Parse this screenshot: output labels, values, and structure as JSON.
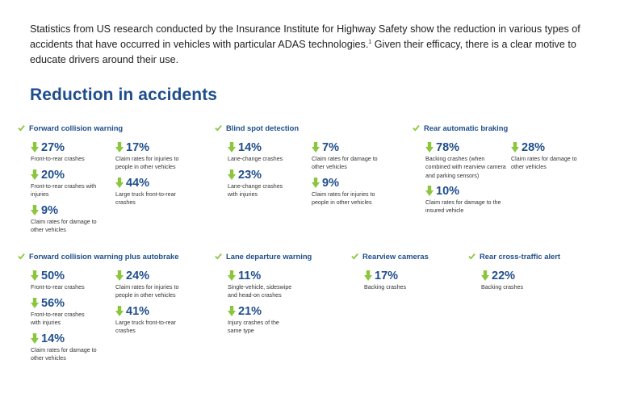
{
  "intro": {
    "text": "Statistics from US research conducted by the Insurance Institute for Highway Safety show the reduction in various types of accidents that have occurred in vehicles with particular ADAS technologies.",
    "footnote": "1",
    "text_after": " Given their efficacy, there is a clear motive to educate drivers around their use."
  },
  "heading": "Reduction in accidents",
  "colors": {
    "heading": "#1f4e8c",
    "arrow": "#8cc63f",
    "check": "#8cc63f"
  },
  "sections": [
    {
      "title": "Forward collision warning",
      "stats": [
        {
          "value": "27%",
          "label": "Front-to-rear crashes"
        },
        {
          "value": "20%",
          "label": "Front-to-rear crashes with injuries"
        },
        {
          "value": "9%",
          "label": "Claim rates for damage to other vehicles"
        },
        {
          "value": "17%",
          "label": "Claim rates for injuries to people in other vehicles"
        },
        {
          "value": "44%",
          "label": "Large truck front-to-rear crashes"
        }
      ]
    },
    {
      "title": "Blind spot detection",
      "stats": [
        {
          "value": "14%",
          "label": "Lane-change crashes"
        },
        {
          "value": "23%",
          "label": "Lane-change crashes with injuries"
        },
        {
          "value": "7%",
          "label": "Claim rates for damage to other vehicles"
        },
        {
          "value": "9%",
          "label": "Claim rates for injuries to people in other vehicles"
        }
      ]
    },
    {
      "title": "Rear automatic braking",
      "stats": [
        {
          "value": "78%",
          "label": "Backing crashes (when combined with rearview camera and parking sensors)"
        },
        {
          "value": "10%",
          "label": "Claim rates for damage to the insured vehicle"
        },
        {
          "value": "28%",
          "label": "Claim rates for damage to other vehicles"
        }
      ]
    },
    {
      "title": "Forward collision warning plus autobrake",
      "stats": [
        {
          "value": "50%",
          "label": "Front-to-rear crashes"
        },
        {
          "value": "56%",
          "label": "Front-to-rear crashes with injuries"
        },
        {
          "value": "14%",
          "label": "Claim rates for damage to other vehicles"
        },
        {
          "value": "24%",
          "label": "Claim rates for injuries to people in other vehicles"
        },
        {
          "value": "41%",
          "label": "Large truck front-to-rear crashes"
        }
      ]
    },
    {
      "title": "Lane departure warning",
      "stats": [
        {
          "value": "11%",
          "label": "Single-vehicle, sideswipe and head-on crashes"
        },
        {
          "value": "21%",
          "label": "Injury crashes of the same type"
        }
      ]
    },
    {
      "title": "Rearview cameras",
      "stats": [
        {
          "value": "17%",
          "label": "Backing crashes"
        }
      ]
    },
    {
      "title": "Rear cross-traffic alert",
      "stats": [
        {
          "value": "22%",
          "label": "Backing crashes"
        }
      ]
    }
  ]
}
